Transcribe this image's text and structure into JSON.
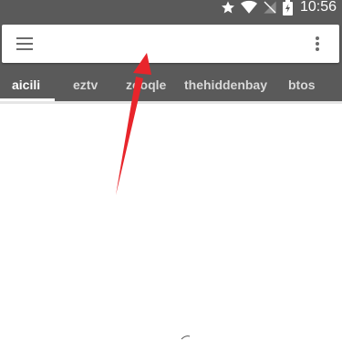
{
  "status_bar": {
    "time": "10:56",
    "icons": [
      "star-icon",
      "wifi-icon",
      "no-signal-icon",
      "battery-charging-icon"
    ]
  },
  "search": {
    "value": "",
    "placeholder": "",
    "menu_icon": "menu-icon",
    "more_icon": "more-vertical-icon"
  },
  "tabs": [
    {
      "label": "aicili",
      "active": true
    },
    {
      "label": "eztv",
      "active": false
    },
    {
      "label": "zooqle",
      "active": false
    },
    {
      "label": "thehiddenbay",
      "active": false
    },
    {
      "label": "btos",
      "active": false
    }
  ],
  "colors": {
    "header_bg": "#5a5a5a",
    "tab_active": "#ffffff",
    "tab_inactive": "#d8d8d8",
    "annotation_arrow": "#e8252b"
  }
}
